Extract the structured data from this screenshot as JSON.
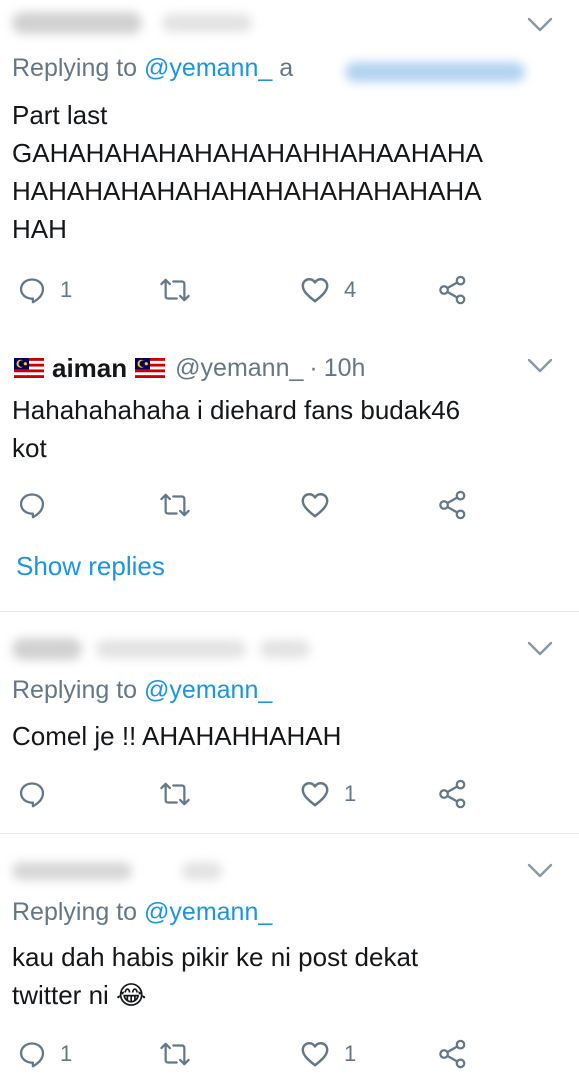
{
  "tweets": [
    {
      "replying_label": "Replying to",
      "replying_handle": "@yemann_",
      "reply_extra": "a",
      "text_lines": [
        "Part last",
        "GAHAHAHAHAHAHAHAHHAHAAHAHA",
        "HAHAHAHAHAHAHAHAHAHAHAHAHA",
        "HAH"
      ],
      "reply_count": "1",
      "retweet_count": "",
      "like_count": "4"
    },
    {
      "author": "aiman",
      "handle": "@yemann_",
      "separator": "·",
      "time": "10h",
      "text_lines": [
        "Hahahahahaha i diehard fans budak46",
        "kot"
      ],
      "reply_count": "",
      "retweet_count": "",
      "like_count": "",
      "show_replies": "Show replies"
    },
    {
      "replying_label": "Replying to",
      "replying_handle": "@yemann_",
      "text_lines": [
        "Comel je !! AHAHAHHAHAH"
      ],
      "reply_count": "",
      "retweet_count": "",
      "like_count": "1"
    },
    {
      "replying_label": "Replying to",
      "replying_handle": "@yemann_",
      "text_lines": [
        "kau dah habis pikir ke ni post dekat",
        "twitter ni 😂"
      ],
      "reply_count": "1",
      "retweet_count": "",
      "like_count": "1"
    }
  ],
  "icons": {
    "reply": "reply-icon",
    "retweet": "retweet-icon",
    "like": "heart-icon",
    "share": "share-icon",
    "more": "chevron-down-icon",
    "flag": "malaysia-flag-icon"
  },
  "colors": {
    "link": "#1b95e0",
    "secondary_text": "#657786",
    "primary_text": "#14171a",
    "divider": "#e1e8ed"
  }
}
